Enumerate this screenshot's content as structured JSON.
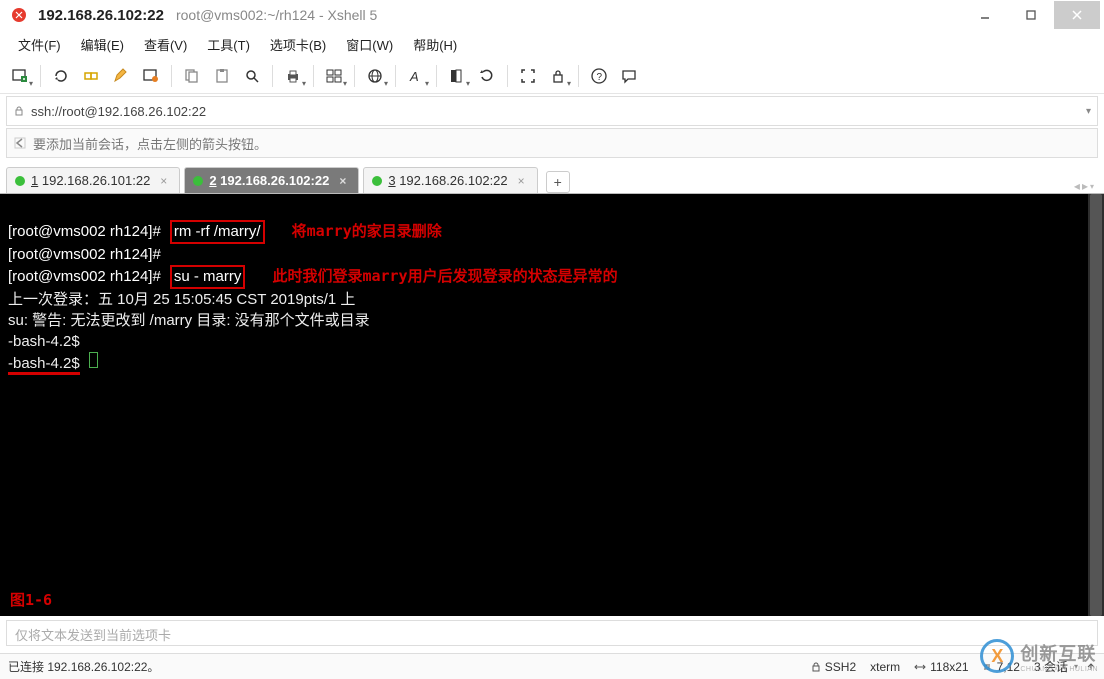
{
  "window": {
    "title_strong": "192.168.26.102:22",
    "title_rest": "root@vms002:~/rh124 - Xshell 5"
  },
  "menu": {
    "file": "文件(F)",
    "edit": "编辑(E)",
    "view": "查看(V)",
    "tools": "工具(T)",
    "tab": "选项卡(B)",
    "window": "窗口(W)",
    "help": "帮助(H)"
  },
  "address": {
    "url": "ssh://root@192.168.26.102:22"
  },
  "hint": {
    "text": "要添加当前会话，点击左侧的箭头按钮。"
  },
  "tabs": [
    {
      "num": "1",
      "label": "192.168.26.101:22",
      "active": false
    },
    {
      "num": "2",
      "label": "192.168.26.102:22",
      "active": true
    },
    {
      "num": "3",
      "label": "192.168.26.102:22",
      "active": false
    }
  ],
  "terminal": {
    "line1_prompt": "[root@vms002 rh124]#",
    "line1_cmd": "rm -rf /marry/",
    "line1_annot": "将marry的家目录删除",
    "line2_prompt": "[root@vms002 rh124]#",
    "line3_prompt": "[root@vms002 rh124]#",
    "line3_cmd": "su - marry",
    "line3_annot": "此时我们登录marry用户后发现登录的状态是异常的",
    "line4": "上一次登录：五 10月 25 15:05:45 CST 2019pts/1 上",
    "line5": "su: 警告: 无法更改到 /marry 目录: 没有那个文件或目录",
    "line6": "-bash-4.2$",
    "line7": "-bash-4.2$",
    "figure": "图1-6"
  },
  "input_hint": "仅将文本发送到当前选项卡",
  "status": {
    "connected": "已连接 192.168.26.102:22。",
    "proto": "SSH2",
    "term": "xterm",
    "size": "118x21",
    "pos": "7,12",
    "sessions": "3 会话"
  },
  "watermark": {
    "big": "创新互联",
    "sub": "CHUANGXIN HULIAN"
  }
}
